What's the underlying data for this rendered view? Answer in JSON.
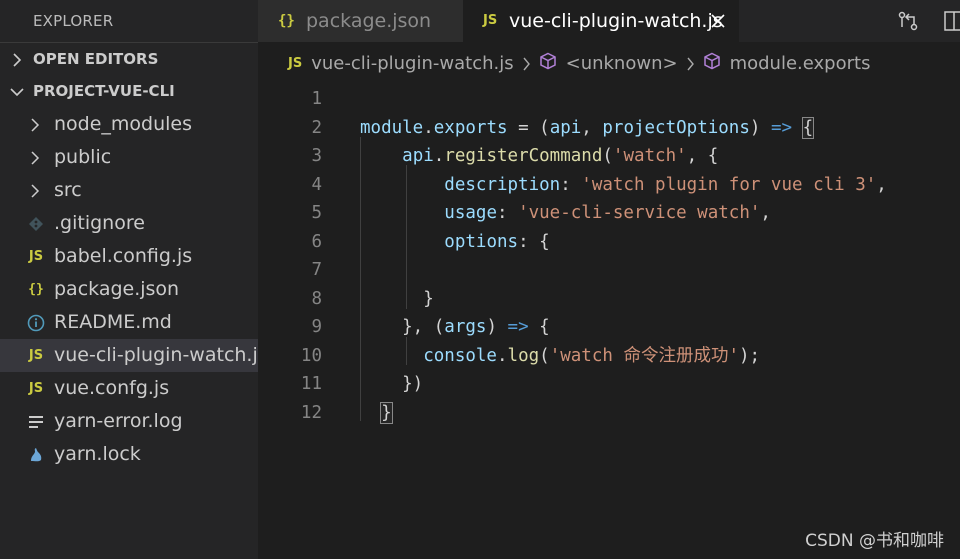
{
  "sidebar": {
    "title": "EXPLORER",
    "open_editors": "OPEN EDITORS",
    "project": "PROJECT-VUE-CLI",
    "items": [
      {
        "label": "node_modules",
        "type": "folder"
      },
      {
        "label": "public",
        "type": "folder"
      },
      {
        "label": "src",
        "type": "folder"
      },
      {
        "label": ".gitignore",
        "type": "git"
      },
      {
        "label": "babel.config.js",
        "type": "js"
      },
      {
        "label": "package.json",
        "type": "json"
      },
      {
        "label": "README.md",
        "type": "info"
      },
      {
        "label": "vue-cli-plugin-watch.js",
        "type": "js",
        "selected": true
      },
      {
        "label": "vue.confg.js",
        "type": "js"
      },
      {
        "label": "yarn-error.log",
        "type": "log"
      },
      {
        "label": "yarn.lock",
        "type": "yarn"
      }
    ]
  },
  "tabs": [
    {
      "label": "package.json",
      "icon": "json-icon",
      "active": false
    },
    {
      "label": "vue-cli-plugin-watch.js",
      "icon": "js-icon",
      "active": true
    }
  ],
  "breadcrumb": {
    "file": "vue-cli-plugin-watch.js",
    "symbol1": "<unknown>",
    "symbol2": "module.exports"
  },
  "editor": {
    "line_numbers": [
      "1",
      "2",
      "3",
      "4",
      "5",
      "6",
      "7",
      "8",
      "9",
      "10",
      "11",
      "12"
    ],
    "lines": [
      [],
      [
        [
          "var",
          "module"
        ],
        [
          "punc",
          "."
        ],
        [
          "var",
          "exports"
        ],
        [
          "punc",
          " = ("
        ],
        [
          "var",
          "api"
        ],
        [
          "punc",
          ", "
        ],
        [
          "var",
          "projectOptions"
        ],
        [
          "punc",
          ") "
        ],
        [
          "kw",
          "=>"
        ],
        [
          "punc",
          " "
        ],
        [
          "bm",
          "{"
        ]
      ],
      [
        [
          "punc",
          "    "
        ],
        [
          "var",
          "api"
        ],
        [
          "punc",
          "."
        ],
        [
          "fn",
          "registerCommand"
        ],
        [
          "punc",
          "("
        ],
        [
          "str",
          "'watch'"
        ],
        [
          "punc",
          ", {"
        ]
      ],
      [
        [
          "punc",
          "        "
        ],
        [
          "var",
          "description"
        ],
        [
          "punc",
          ": "
        ],
        [
          "str",
          "'watch plugin for vue cli 3'"
        ],
        [
          "punc",
          ","
        ]
      ],
      [
        [
          "punc",
          "        "
        ],
        [
          "var",
          "usage"
        ],
        [
          "punc",
          ": "
        ],
        [
          "str",
          "'vue-cli-service watch'"
        ],
        [
          "punc",
          ","
        ]
      ],
      [
        [
          "punc",
          "        "
        ],
        [
          "var",
          "options"
        ],
        [
          "punc",
          ": {"
        ]
      ],
      [],
      [
        [
          "punc",
          "      }"
        ]
      ],
      [
        [
          "punc",
          "    }, ("
        ],
        [
          "var",
          "args"
        ],
        [
          "punc",
          ") "
        ],
        [
          "kw",
          "=>"
        ],
        [
          "punc",
          " {"
        ]
      ],
      [
        [
          "punc",
          "      "
        ],
        [
          "var",
          "console"
        ],
        [
          "punc",
          "."
        ],
        [
          "fn",
          "log"
        ],
        [
          "punc",
          "("
        ],
        [
          "str",
          "'watch 命令注册成功'"
        ],
        [
          "punc",
          ");"
        ]
      ],
      [
        [
          "punc",
          "    })"
        ]
      ],
      [
        [
          "punc",
          "  "
        ],
        [
          "bm",
          "}"
        ]
      ]
    ]
  },
  "colors": {
    "background": "#1e1e1e",
    "sidebar": "#252526",
    "js_badge": "#cbcb41",
    "variable": "#9cdcfe",
    "string": "#ce9178",
    "keyword": "#569cd6",
    "function": "#dcdcaa"
  },
  "watermark": "CSDN @书和咖啡"
}
